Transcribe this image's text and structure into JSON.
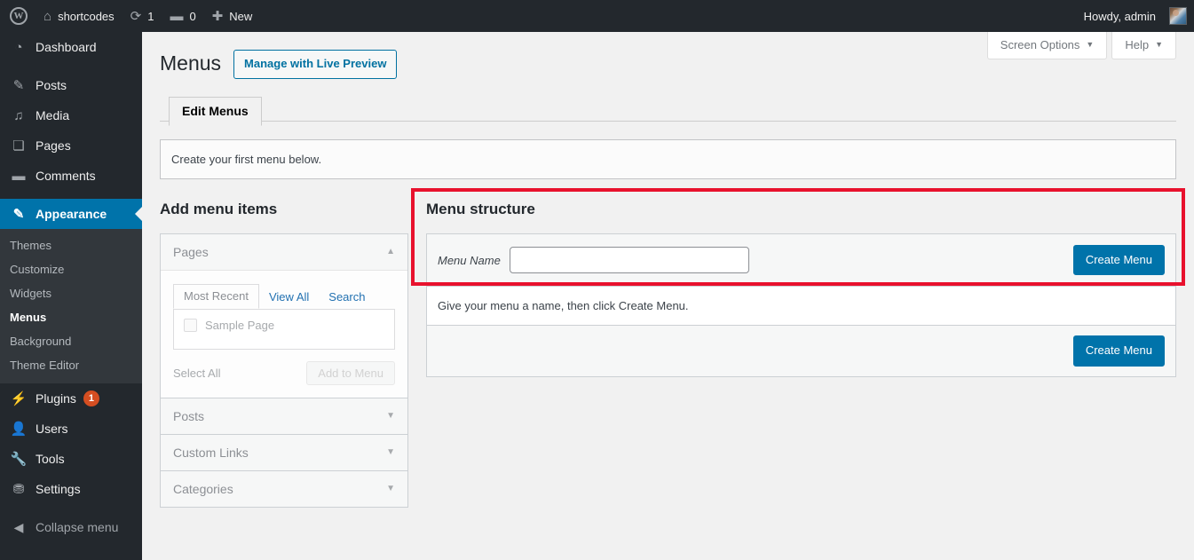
{
  "adminbar": {
    "logo_icon": "wordpress-logo-icon",
    "site_name": "shortcodes",
    "site_icon": "home-icon",
    "updates_icon": "updates-icon",
    "updates_count": "1",
    "comments_icon": "comment-bubble-icon",
    "comments_count": "0",
    "new_icon": "plus-icon",
    "new_label": "New",
    "howdy": "Howdy, admin"
  },
  "sidebar": {
    "items": [
      {
        "label": "Dashboard",
        "icon": "dashboard-icon",
        "name": "dashboard"
      },
      {
        "label": "Posts",
        "icon": "pin-icon",
        "name": "posts"
      },
      {
        "label": "Media",
        "icon": "media-icon",
        "name": "media"
      },
      {
        "label": "Pages",
        "icon": "pages-icon",
        "name": "pages"
      },
      {
        "label": "Comments",
        "icon": "comment-bubble-icon",
        "name": "comments"
      },
      {
        "label": "Appearance",
        "icon": "paintbrush-icon",
        "name": "appearance"
      },
      {
        "label": "Plugins",
        "icon": "plug-icon",
        "name": "plugins",
        "badge": "1"
      },
      {
        "label": "Users",
        "icon": "user-icon",
        "name": "users"
      },
      {
        "label": "Tools",
        "icon": "wrench-icon",
        "name": "tools"
      },
      {
        "label": "Settings",
        "icon": "sliders-icon",
        "name": "settings"
      }
    ],
    "appearance_submenu": [
      {
        "label": "Themes",
        "name": "themes"
      },
      {
        "label": "Customize",
        "name": "customize"
      },
      {
        "label": "Widgets",
        "name": "widgets"
      },
      {
        "label": "Menus",
        "name": "menus"
      },
      {
        "label": "Background",
        "name": "background"
      },
      {
        "label": "Theme Editor",
        "name": "theme-editor"
      }
    ],
    "collapse": {
      "label": "Collapse menu",
      "icon": "collapse-arrow-icon"
    }
  },
  "screen_meta": {
    "screen_options": "Screen Options",
    "help": "Help",
    "caret": "▼"
  },
  "header": {
    "title": "Menus",
    "live_preview_button": "Manage with Live Preview"
  },
  "tabs": [
    {
      "label": "Edit Menus",
      "name": "edit-menus",
      "active": true
    }
  ],
  "notice": {
    "text": "Create your first menu below."
  },
  "add_menu_items": {
    "heading": "Add menu items",
    "sections": [
      {
        "title": "Pages",
        "name": "pages",
        "open": true,
        "arrow": "▲",
        "tabs": [
          {
            "label": "Most Recent",
            "active": true
          },
          {
            "label": "View All",
            "active": false
          },
          {
            "label": "Search",
            "active": false
          }
        ],
        "items": [
          {
            "label": "Sample Page",
            "checked": false
          }
        ],
        "select_all": "Select All",
        "add_button": "Add to Menu"
      },
      {
        "title": "Posts",
        "name": "posts",
        "open": false,
        "arrow": "▼"
      },
      {
        "title": "Custom Links",
        "name": "custom-links",
        "open": false,
        "arrow": "▼"
      },
      {
        "title": "Categories",
        "name": "categories",
        "open": false,
        "arrow": "▼"
      }
    ]
  },
  "menu_structure": {
    "heading": "Menu structure",
    "name_label": "Menu Name",
    "name_value": "",
    "name_placeholder": "",
    "create_button_top": "Create Menu",
    "hint": "Give your menu a name, then click Create Menu.",
    "create_button_bottom": "Create Menu",
    "highlight_color": "#e8112d"
  },
  "colors": {
    "accent": "#0073aa",
    "admin_bar": "#23282d",
    "submenu_bg": "#32373c",
    "badge": "#d54e21",
    "highlight": "#e8112d"
  }
}
